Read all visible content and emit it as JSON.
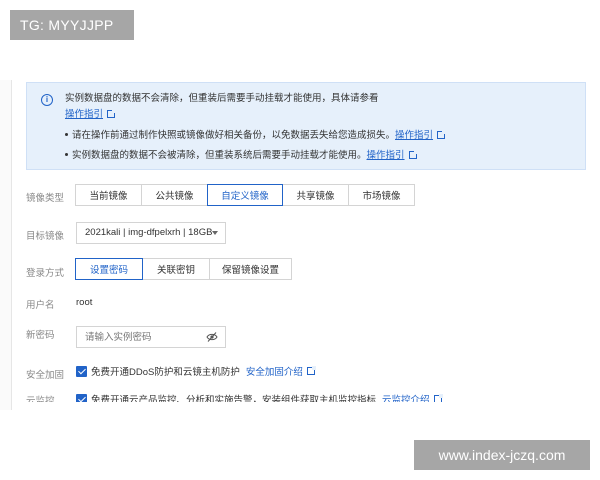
{
  "watermarks": {
    "top_left": "TG: MYYJJPP",
    "bottom_right": "www.index-jczq.com"
  },
  "notice": {
    "title": "实例数据盘的数据不会清除，但重装后需要手动挂载才能使用，具体请参看",
    "title_link": "操作指引",
    "bullets": [
      {
        "text": "请在操作前通过制作快照或镜像做好相关备份，以免数据丢失给您造成损失。",
        "link": "操作指引"
      },
      {
        "text": "实例数据盘的数据不会被清除，但重装系统后需要手动挂载才能使用。",
        "link": "操作指引"
      }
    ]
  },
  "image_type": {
    "label": "镜像类型",
    "options": [
      "当前镜像",
      "公共镜像",
      "自定义镜像",
      "共享镜像",
      "市场镜像"
    ],
    "selected": "自定义镜像"
  },
  "target_image": {
    "label": "目标镜像",
    "value": "2021kali | img-dfpelxrh | 18GB"
  },
  "login_method": {
    "label": "登录方式",
    "options": [
      "设置密码",
      "关联密钥",
      "保留镜像设置"
    ],
    "selected": "设置密码"
  },
  "username": {
    "label": "用户名",
    "value": "root"
  },
  "new_password": {
    "label": "新密码",
    "placeholder": "请输入实例密码"
  },
  "security": {
    "label": "安全加固",
    "text": "免费开通DDoS防护和云镜主机防护",
    "link": "安全加固介绍"
  },
  "monitoring": {
    "label": "云监控",
    "text": "免费开通云产品监控、分析和实施告警，安装组件获取主机监控指标",
    "link": "云监控介绍"
  },
  "colors": {
    "accent": "#2163c8",
    "notice_bg": "#e6f0fb"
  }
}
